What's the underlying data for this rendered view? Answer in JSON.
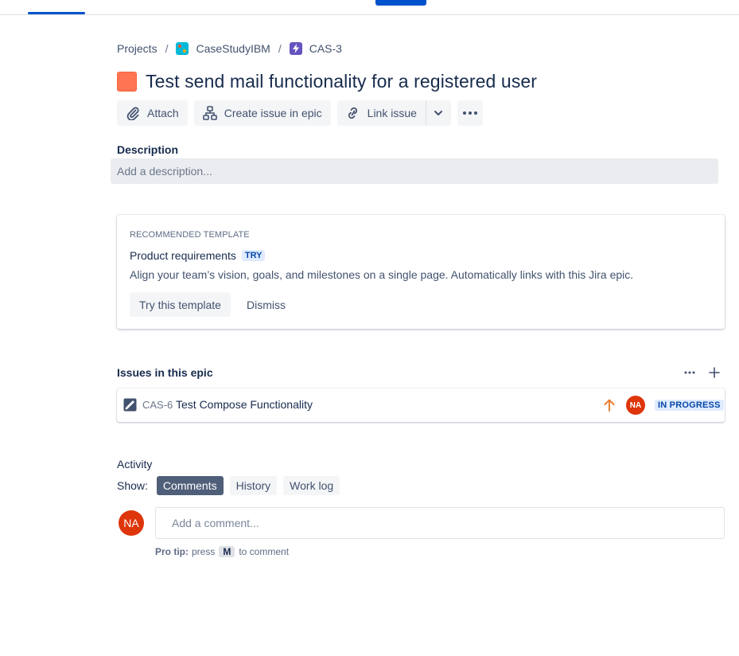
{
  "breadcrumb": {
    "projects": "Projects",
    "separator": "/",
    "project_name": "CaseStudyIBM",
    "epic_key": "CAS-3"
  },
  "issue": {
    "title": "Test send mail functionality for a registered user",
    "type_color": "#ff7452"
  },
  "toolbar": {
    "attach_label": "Attach",
    "create_in_epic_label": "Create issue in epic",
    "link_issue_label": "Link issue"
  },
  "description": {
    "label": "Description",
    "placeholder": "Add a description..."
  },
  "template_card": {
    "kicker": "RECOMMENDED TEMPLATE",
    "title": "Product requirements",
    "badge": "TRY",
    "text": "Align your team’s vision, goals, and milestones on a single page. Automatically links with this Jira epic.",
    "try_label": "Try this template",
    "dismiss_label": "Dismiss"
  },
  "epic_issues": {
    "label": "Issues in this epic",
    "items": [
      {
        "key": "CAS-6",
        "summary": "Test Compose Functionality",
        "priority_icon": "arrow-up-icon",
        "assignee_initials": "NA",
        "status": "IN PROGRESS"
      }
    ]
  },
  "activity": {
    "label": "Activity",
    "show_label": "Show:",
    "filters": [
      "Comments",
      "History",
      "Work log"
    ],
    "active_filter": "Comments",
    "avatar_initials": "NA",
    "comment_placeholder": "Add a comment...",
    "protip_label": "Pro tip:",
    "protip_pre": "press",
    "protip_key": "M",
    "protip_post": "to comment"
  },
  "colors": {
    "accent": "#0052cc",
    "avatar": "#de350b",
    "status_bg": "#deebff",
    "status_fg": "#0747a6"
  }
}
